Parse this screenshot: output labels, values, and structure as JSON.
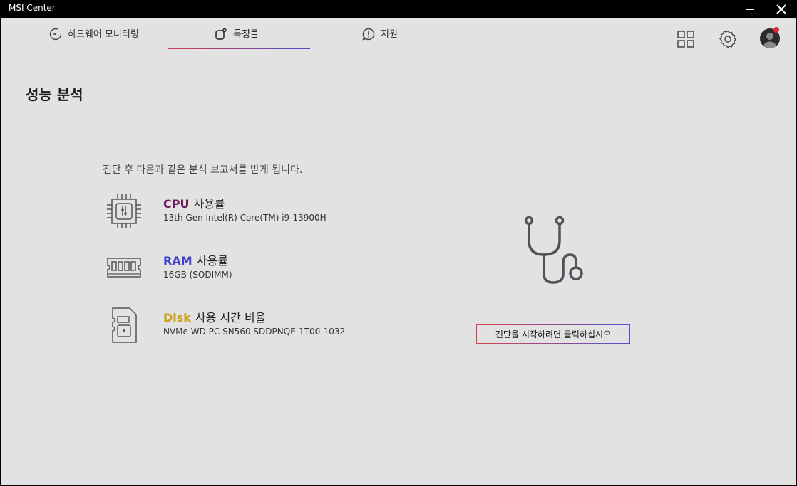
{
  "window": {
    "title": "MSI Center"
  },
  "nav": {
    "tabs": [
      {
        "label": "하드웨어 모니터링",
        "icon": "gauge-icon"
      },
      {
        "label": "특징들",
        "icon": "features-icon",
        "active": true
      },
      {
        "label": "지원",
        "icon": "support-chat-icon"
      }
    ],
    "right_icons": [
      "apps-grid-icon",
      "gear-icon",
      "avatar"
    ]
  },
  "page": {
    "title": "성능 분석",
    "intro": "진단 후 다음과 같은 분석 보고서를 받게 됩니다.",
    "items": [
      {
        "highlight": "CPU",
        "label": "사용률",
        "detail": "13th Gen Intel(R) Core(TM) i9-13900H",
        "icon": "cpu-icon",
        "color": "#6a1a5a"
      },
      {
        "highlight": "RAM",
        "label": "사용률",
        "detail": "16GB (SODIMM)",
        "icon": "ram-icon",
        "color": "#3d40c9"
      },
      {
        "highlight": "Disk",
        "label": "사용 시간 비율",
        "detail": "NVMe WD PC SN560 SDDPNQE-1T00-1032",
        "icon": "disk-icon",
        "color": "#c9a216"
      }
    ],
    "start_button": "진단을 시작하려면 클릭하십시오",
    "illustration_icon": "stethoscope-icon"
  },
  "colors": {
    "accent_red": "#d33a4a",
    "accent_blue": "#4a4fd1",
    "background": "#e2e2e2",
    "notification": "#e02b37"
  }
}
